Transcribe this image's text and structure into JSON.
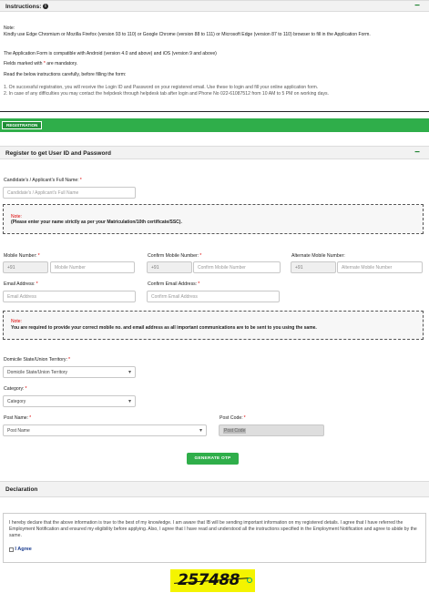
{
  "instructions": {
    "title": "Instructions:",
    "note_label": "Note:",
    "browser_note": "Kindly use Edge Chromium or Mozilla Firefox (version 93 to 110) or Google Chrome (version 88 to 111) or Microsoft Edge (version 87 to 110) browser to fill in the Application Form.",
    "compat_note": "The Application Form is compatible with Android (version 4.0 and above) and iOS (version 9 and above)",
    "mandatory_prefix": "Fields marked with",
    "mandatory_suffix": "are mandatory.",
    "read_note": "Read the below instructions carefully, before filling the form:",
    "items": [
      "1. On successful registration, you will receive the Login ID and Password on your registered email. Use these to login and fill your online application form.",
      "2. In case of any difficulties you may contact the helpdesk through helpdesk tab after login and Phone No 022-61087512 from 10 AM to 5 PM on working days."
    ]
  },
  "registration_tab": "REGISTRATION",
  "register": {
    "title": "Register to get User ID and Password",
    "full_name_label": "Candidate's / Applicant's Full Name:",
    "full_name_placeholder": "Candidate's / Applicant's Full Name",
    "name_note_label": "Note:",
    "name_note_text": "(Please enter your name strictly as per your Matriculation/10th certificate/SSC).",
    "mobile_label": "Mobile Number:",
    "confirm_mobile_label": "Confirm Mobile Number:",
    "alt_mobile_label": "Alternate Mobile Number:",
    "country_code": "+91",
    "mobile_placeholder": "Mobile Number",
    "confirm_mobile_placeholder": "Confirm Mobile Number",
    "alt_mobile_placeholder": "Alternate Mobile Number",
    "email_label": "Email Address:",
    "confirm_email_label": "Confirm Email Address:",
    "email_placeholder": "Email Address",
    "confirm_email_placeholder": "Confirm Email Address",
    "contact_note_label": "Note:",
    "contact_note_text": "You are required to provide your correct mobile no. and email address as all important communications are to be sent to you using the same.",
    "domicile_label": "Domicile State/Union Territory:",
    "domicile_value": "Domicile State/Union Territory",
    "category_label": "Category:",
    "category_value": "Category",
    "post_name_label": "Post Name:",
    "post_name_value": "Post Name",
    "post_code_label": "Post Code:",
    "post_code_value": "Post Code",
    "generate_otp": "GENERATE OTP"
  },
  "declaration": {
    "title": "Declaration",
    "text": "I hereby declare that the above information is true to the best of my knowledge. I am aware that IB will be sending important information on my registered details. I agree that I have referred the Employment Notification and ensured my eligibility before applying. Also, I agree that I have read and understood all the instructions specified in the Employment Notification and agree to abide by the same.",
    "agree_label": "I Agree"
  },
  "captcha": {
    "value": "257488"
  },
  "colors": {
    "green": "#2fae4a",
    "red": "#dd0000"
  }
}
